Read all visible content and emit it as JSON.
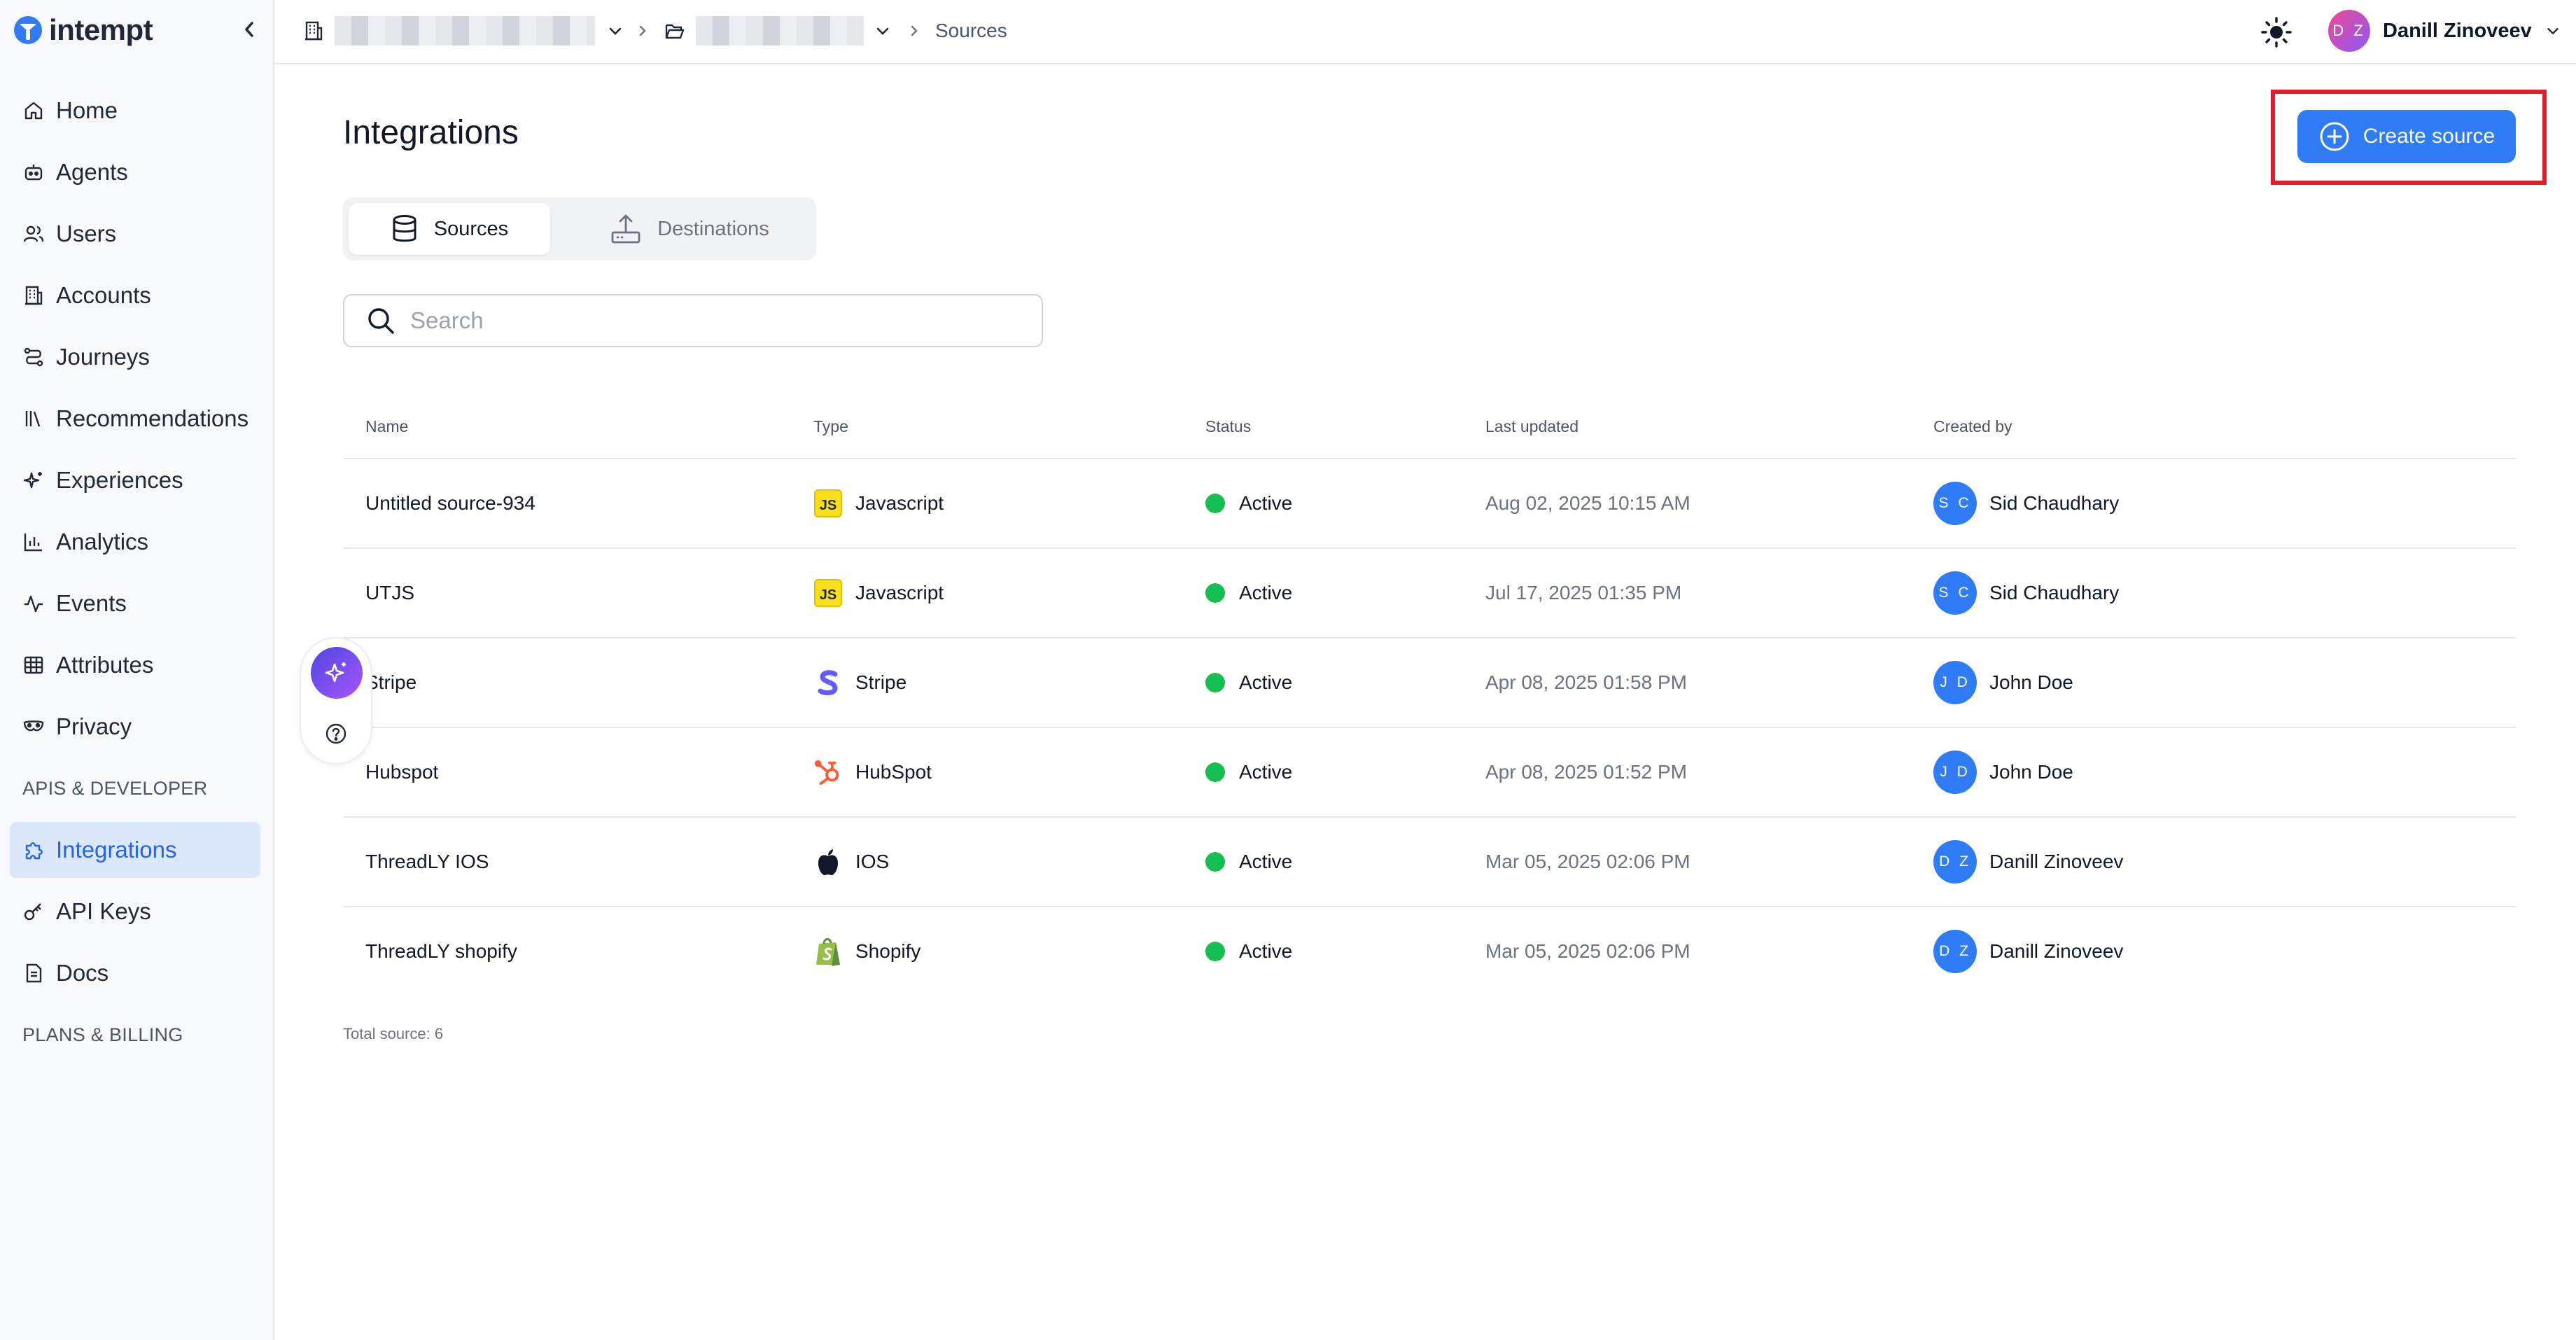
{
  "brand": {
    "name": "intempt",
    "accent": "#2f7cf6"
  },
  "sidebar": {
    "items": [
      {
        "label": "Home",
        "icon": "home-icon"
      },
      {
        "label": "Agents",
        "icon": "robot-icon"
      },
      {
        "label": "Users",
        "icon": "users-icon"
      },
      {
        "label": "Accounts",
        "icon": "building-icon"
      },
      {
        "label": "Journeys",
        "icon": "route-icon"
      },
      {
        "label": "Recommendations",
        "icon": "library-icon"
      },
      {
        "label": "Experiences",
        "icon": "sparkles-icon"
      },
      {
        "label": "Analytics",
        "icon": "bar-chart-icon"
      },
      {
        "label": "Events",
        "icon": "activity-icon"
      },
      {
        "label": "Attributes",
        "icon": "table-icon"
      },
      {
        "label": "Privacy",
        "icon": "mask-icon"
      }
    ],
    "section_apis": "APIS & DEVELOPER",
    "dev_items": [
      {
        "label": "Integrations",
        "icon": "puzzle-icon",
        "active": true
      },
      {
        "label": "API Keys",
        "icon": "key-icon"
      },
      {
        "label": "Docs",
        "icon": "file-icon"
      }
    ],
    "section_billing": "PLANS & BILLING"
  },
  "topbar": {
    "breadcrumb_current": "Sources",
    "user_initials": "D Z",
    "user_name": "Danill Zinoveev"
  },
  "page": {
    "title": "Integrations",
    "create_button": "Create source",
    "tabs": [
      {
        "label": "Sources",
        "icon": "database-icon",
        "active": true
      },
      {
        "label": "Destinations",
        "icon": "upload-icon",
        "active": false
      }
    ],
    "search_placeholder": "Search"
  },
  "table": {
    "headers": {
      "name": "Name",
      "type": "Type",
      "status": "Status",
      "last_updated": "Last updated",
      "created_by": "Created by"
    },
    "rows": [
      {
        "name": "Untitled source-934",
        "type": "Javascript",
        "type_icon": "js-icon",
        "status": "Active",
        "last_updated": "Aug 02, 2025 10:15 AM",
        "initials": "S C",
        "created_by": "Sid Chaudhary"
      },
      {
        "name": "UTJS",
        "type": "Javascript",
        "type_icon": "js-icon",
        "status": "Active",
        "last_updated": "Jul 17, 2025 01:35 PM",
        "initials": "S C",
        "created_by": "Sid Chaudhary"
      },
      {
        "name": "Stripe",
        "type": "Stripe",
        "type_icon": "stripe-icon",
        "status": "Active",
        "last_updated": "Apr 08, 2025 01:58 PM",
        "initials": "J D",
        "created_by": "John Doe"
      },
      {
        "name": "Hubspot",
        "type": "HubSpot",
        "type_icon": "hubspot-icon",
        "status": "Active",
        "last_updated": "Apr 08, 2025 01:52 PM",
        "initials": "J D",
        "created_by": "John Doe"
      },
      {
        "name": "ThreadLY IOS",
        "type": "IOS",
        "type_icon": "apple-icon",
        "status": "Active",
        "last_updated": "Mar 05, 2025 02:06 PM",
        "initials": "D Z",
        "created_by": "Danill Zinoveev"
      },
      {
        "name": "ThreadLY shopify",
        "type": "Shopify",
        "type_icon": "shopify-icon",
        "status": "Active",
        "last_updated": "Mar 05, 2025 02:06 PM",
        "initials": "D Z",
        "created_by": "Danill Zinoveev"
      }
    ],
    "total": "Total source: 6"
  }
}
